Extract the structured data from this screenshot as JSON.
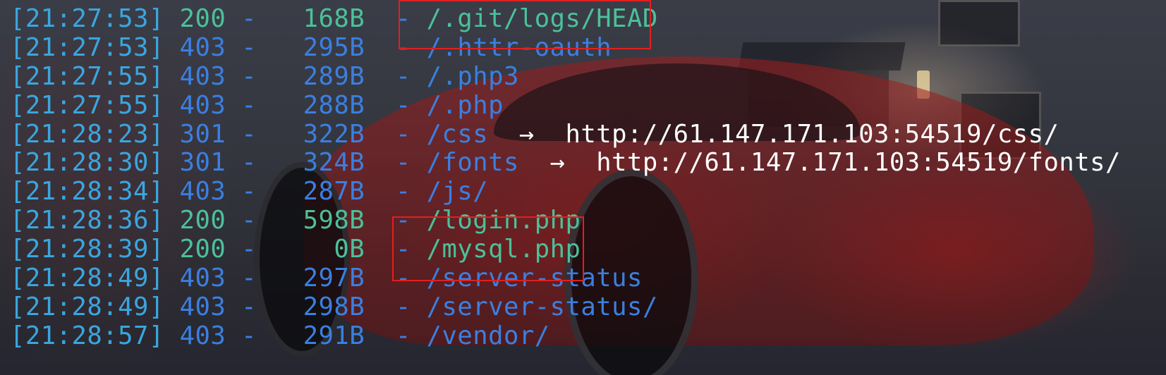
{
  "terminal": {
    "lines": [
      {
        "time": "[21:27:53]",
        "status": "200",
        "size": "168B",
        "path": "/.git/logs/HEAD",
        "redirect": ""
      },
      {
        "time": "[21:27:53]",
        "status": "403",
        "size": "295B",
        "path": "/.httr-oauth",
        "redirect": ""
      },
      {
        "time": "[21:27:55]",
        "status": "403",
        "size": "289B",
        "path": "/.php3",
        "redirect": ""
      },
      {
        "time": "[21:27:55]",
        "status": "403",
        "size": "288B",
        "path": "/.php",
        "redirect": ""
      },
      {
        "time": "[21:28:23]",
        "status": "301",
        "size": "322B",
        "path": "/css",
        "redirect": "http://61.147.171.103:54519/css/"
      },
      {
        "time": "[21:28:30]",
        "status": "301",
        "size": "324B",
        "path": "/fonts",
        "redirect": "http://61.147.171.103:54519/fonts/"
      },
      {
        "time": "[21:28:34]",
        "status": "403",
        "size": "287B",
        "path": "/js/",
        "redirect": ""
      },
      {
        "time": "[21:28:36]",
        "status": "200",
        "size": "598B",
        "path": "/login.php",
        "redirect": ""
      },
      {
        "time": "[21:28:39]",
        "status": "200",
        "size": "0B",
        "path": "/mysql.php",
        "redirect": ""
      },
      {
        "time": "[21:28:49]",
        "status": "403",
        "size": "297B",
        "path": "/server-status",
        "redirect": ""
      },
      {
        "time": "[21:28:49]",
        "status": "403",
        "size": "298B",
        "path": "/server-status/",
        "redirect": ""
      },
      {
        "time": "[21:28:57]",
        "status": "403",
        "size": "291B",
        "path": "/vendor/",
        "redirect": ""
      }
    ],
    "separator": "-",
    "arrow": "→"
  },
  "colors": {
    "time": "#3aa6df",
    "ok": "#4cc09a",
    "other": "#3b7fe0",
    "redirect_url": "#ffffff",
    "highlight_box": "#e02020"
  }
}
